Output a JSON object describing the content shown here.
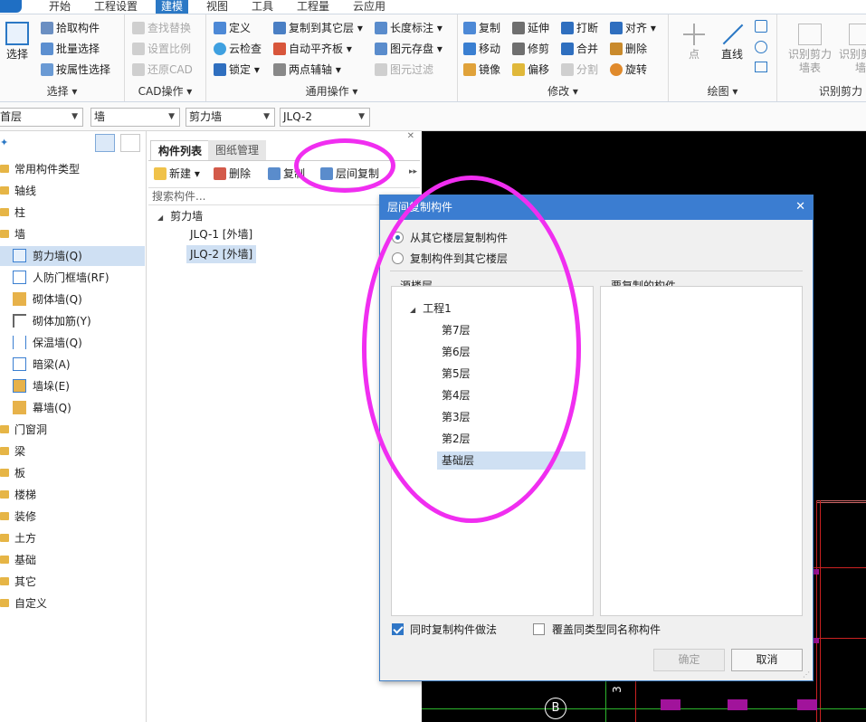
{
  "menu": {
    "tabs": [
      "开始",
      "工程设置",
      "建模",
      "视图",
      "工具",
      "工程量",
      "云应用"
    ]
  },
  "ribbon": {
    "select_group": {
      "big_label": "选择",
      "items": [
        "拾取构件",
        "批量选择",
        "按属性选择"
      ],
      "group_label": "选择 ▾"
    },
    "cad_group": {
      "items": [
        "查找替换",
        "设置比例",
        "还原CAD"
      ],
      "group_label": "CAD操作 ▾"
    },
    "common_group": {
      "items": [
        "定义",
        "云检查",
        "锁定 ▾",
        "复制到其它层 ▾",
        "自动平齐板 ▾",
        "两点辅轴 ▾",
        "长度标注 ▾",
        "图元存盘 ▾",
        "图元过滤"
      ],
      "group_label": "通用操作 ▾"
    },
    "modify_group": {
      "items": [
        "复制",
        "移动",
        "镜像",
        "延伸",
        "修剪",
        "偏移",
        "打断",
        "合并",
        "分割",
        "对齐 ▾",
        "删除",
        "旋转"
      ],
      "group_label": "修改 ▾"
    },
    "draw_group": {
      "items": [
        "点",
        "直线"
      ],
      "group_label": "绘图 ▾"
    },
    "identify_group": {
      "items": [
        "识别剪力墙表",
        "识别剪力墙"
      ],
      "group_label": "识别剪力"
    }
  },
  "toolbar": {
    "floor": "首层",
    "category": "墙",
    "type": "剪力墙",
    "component": "JLQ-2"
  },
  "left_tree": {
    "top_items": [
      "常用构件类型",
      "轴线",
      "柱",
      "墙"
    ],
    "wall_children": [
      "剪力墙(Q)",
      "人防门框墙(RF)",
      "砌体墙(Q)",
      "砌体加筋(Y)",
      "保温墙(Q)",
      "暗梁(A)",
      "墙垛(E)",
      "幕墙(Q)"
    ],
    "bottom_items": [
      "门窗洞",
      "梁",
      "板",
      "楼梯",
      "装修",
      "土方",
      "基础",
      "其它",
      "自定义"
    ]
  },
  "comp_panel": {
    "tabs": [
      "构件列表",
      "图纸管理"
    ],
    "actions": [
      "新建 ▾",
      "删除",
      "复制",
      "层间复制"
    ],
    "search_placeholder": "搜索构件...",
    "tree_root": "剪力墙",
    "tree_items": [
      "JLQ-1 [外墙]",
      "JLQ-2 [外墙]"
    ]
  },
  "canvas": {
    "axis_label": "B",
    "axis_num": "3"
  },
  "dialog": {
    "title": "层间复制构件",
    "radio_copy_from": "从其它楼层复制构件",
    "radio_copy_to": "复制构件到其它楼层",
    "source_label": "源楼层",
    "target_label": "要复制的构件",
    "project": "工程1",
    "floors": [
      "第7层",
      "第6层",
      "第5层",
      "第4层",
      "第3层",
      "第2层",
      "基础层"
    ],
    "chk_copy_method": "同时复制构件做法",
    "chk_overwrite": "覆盖同类型同名称构件",
    "ok": "确定",
    "cancel": "取消",
    "close": "✕"
  },
  "colors": {
    "accent": "#2b78c5",
    "annotation": "#f02ef0",
    "canvas": "#000000"
  }
}
